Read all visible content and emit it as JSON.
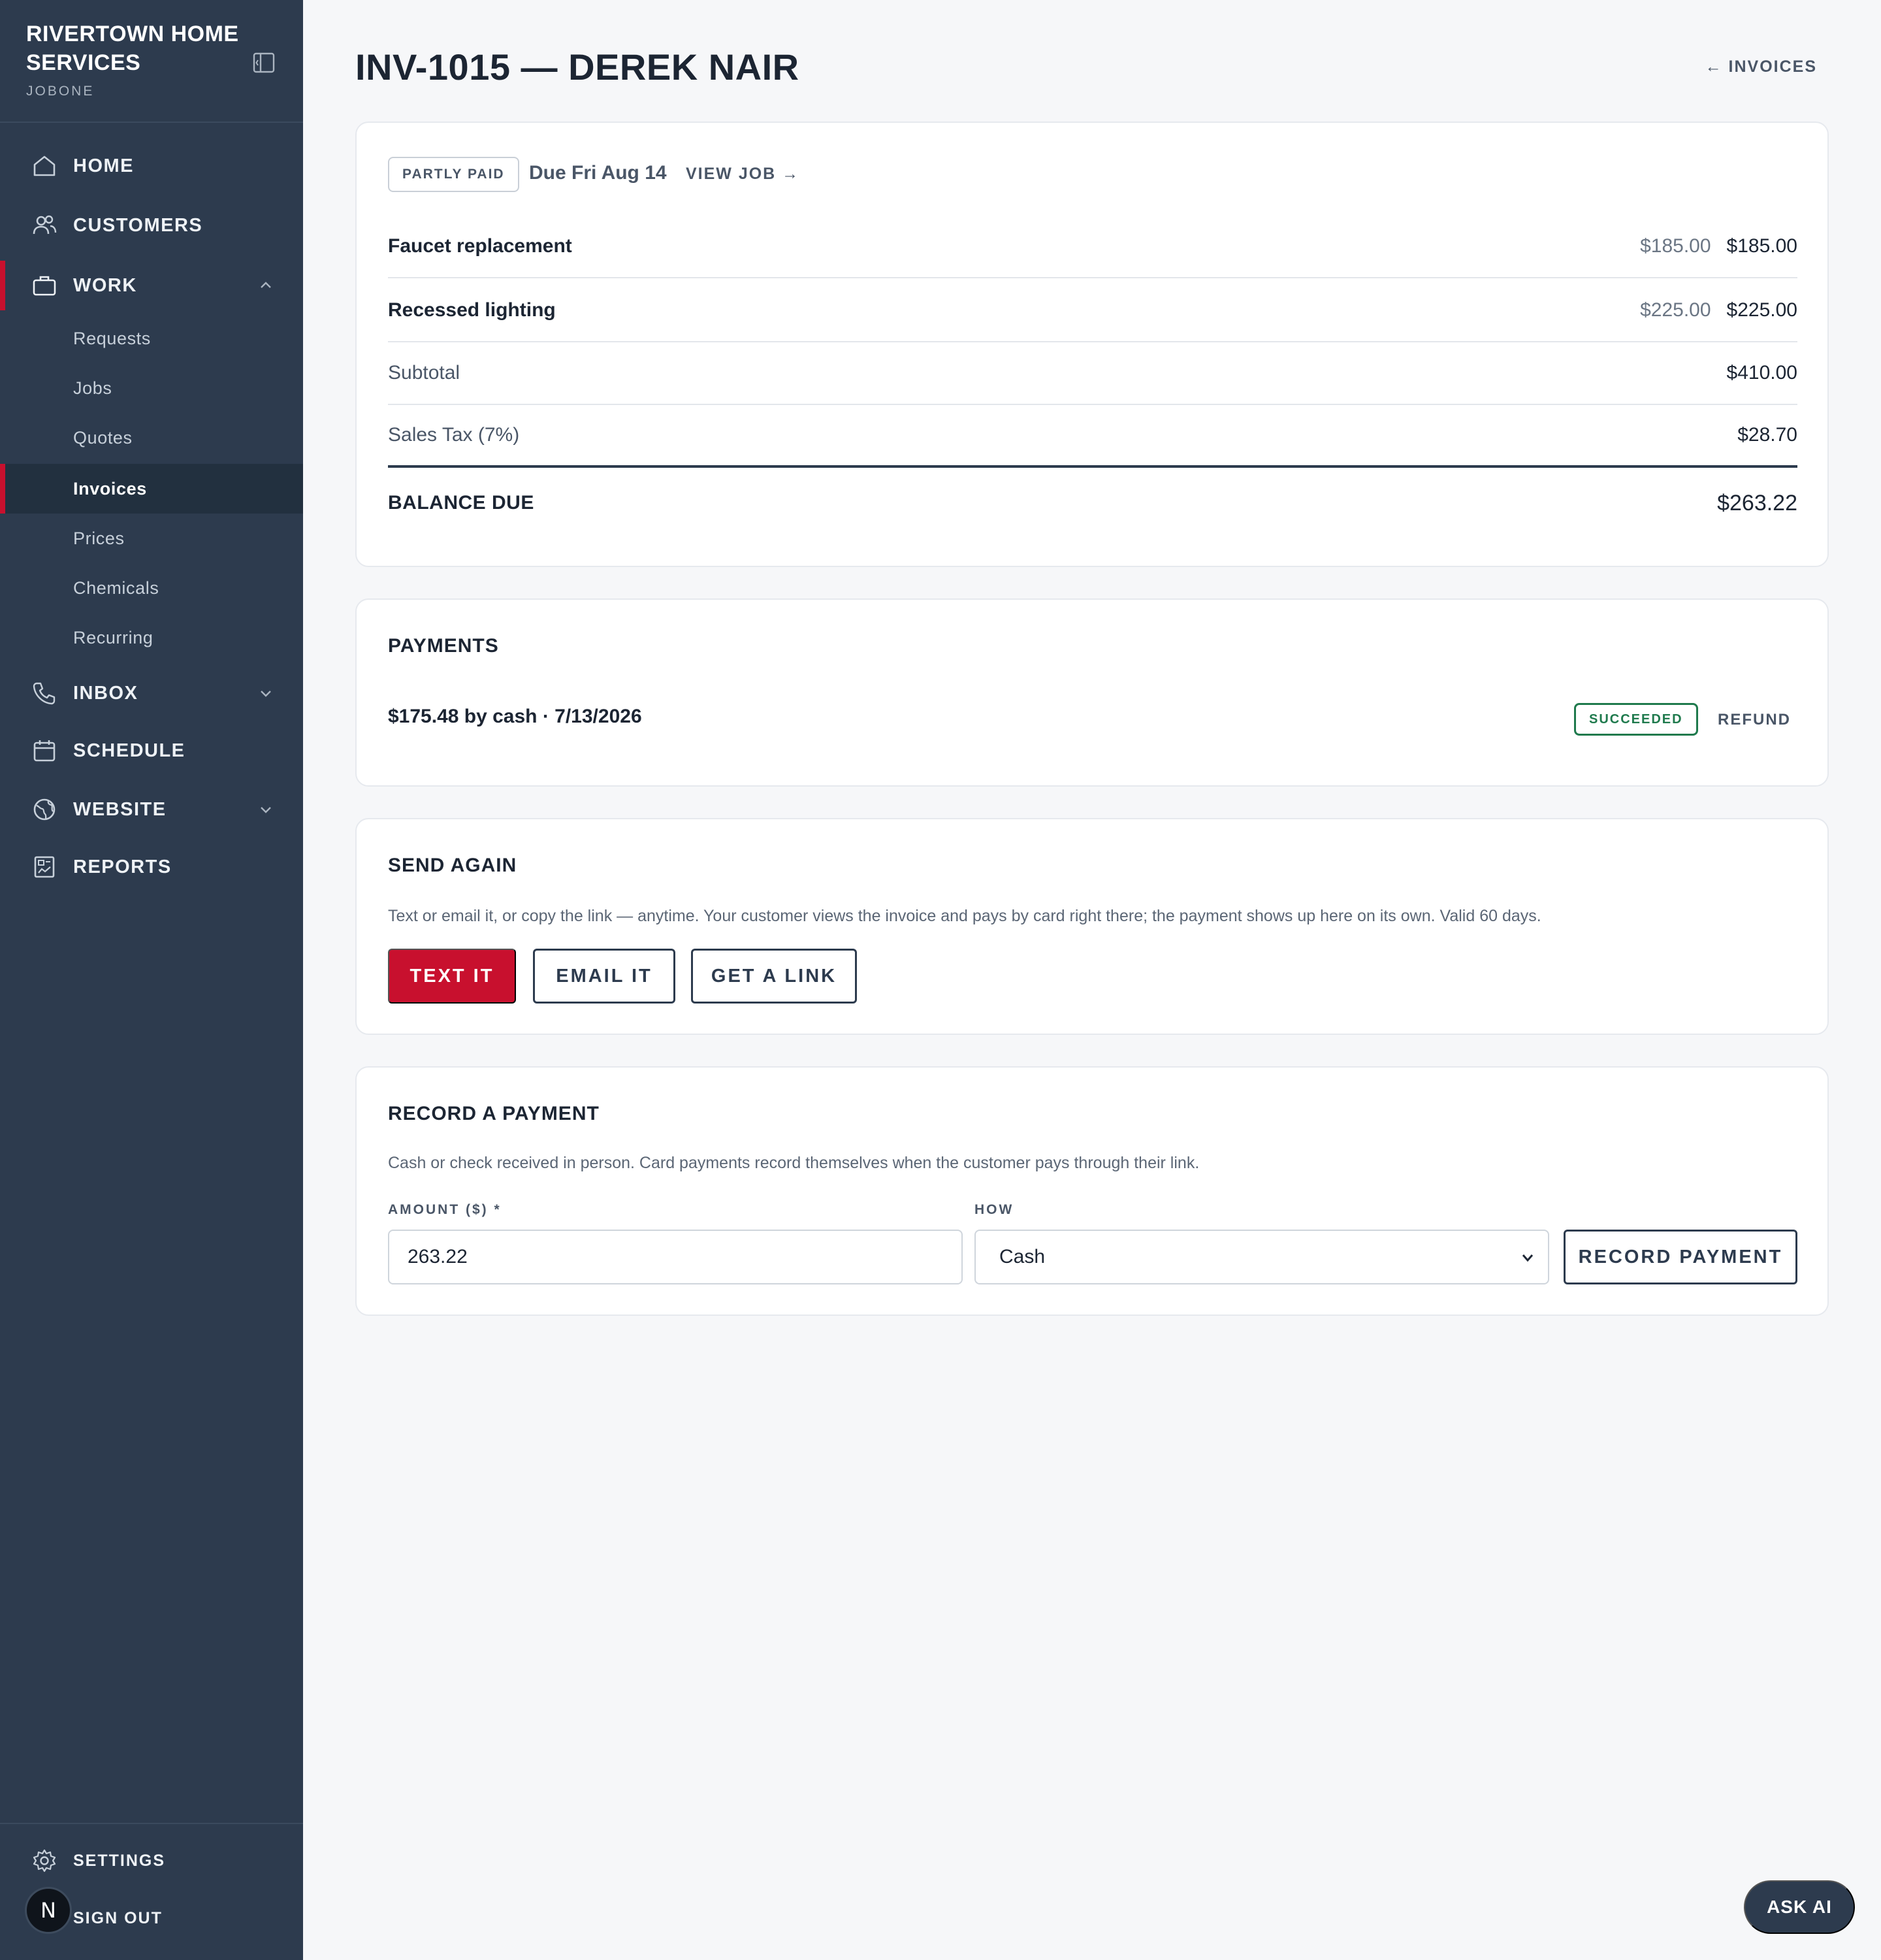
{
  "brand": {
    "name": "RIVERTOWN HOME SERVICES",
    "sub": "JOBONE"
  },
  "nav": {
    "home": "HOME",
    "customers": "CUSTOMERS",
    "work": "WORK",
    "work_items": [
      "Requests",
      "Jobs",
      "Quotes",
      "Invoices",
      "Prices",
      "Chemicals",
      "Recurring"
    ],
    "inbox": "INBOX",
    "schedule": "SCHEDULE",
    "website": "WEBSITE",
    "reports": "REPORTS",
    "settings": "SETTINGS",
    "sign_out": "SIGN OUT",
    "avatar_letter": "N",
    "active_item": "Invoices"
  },
  "page": {
    "title": "INV-1015 — DEREK NAIR",
    "back": "← INVOICES"
  },
  "invoice": {
    "status": "PARTLY PAID",
    "due": "Due Fri Aug 14",
    "view_job": "VIEW JOB →",
    "line_items": [
      {
        "name": "Faucet replacement",
        "unit": "$185.00",
        "total": "$185.00"
      },
      {
        "name": "Recessed lighting",
        "unit": "$225.00",
        "total": "$225.00"
      }
    ],
    "subtotal_label": "Subtotal",
    "subtotal": "$410.00",
    "tax_label": "Sales Tax (7%)",
    "tax": "$28.70",
    "balance_label": "BALANCE DUE",
    "balance": "$263.22"
  },
  "payments": {
    "title": "PAYMENTS",
    "entry": "$175.48 by cash · 7/13/2026",
    "status": "SUCCEEDED",
    "refund": "REFUND"
  },
  "send_again": {
    "title": "SEND AGAIN",
    "help": "Text or email it, or copy the link — anytime. Your customer views the invoice and pays by card right there; the payment shows up here on its own. Valid 60 days.",
    "text_it": "TEXT IT",
    "email_it": "EMAIL IT",
    "get_link": "GET A LINK"
  },
  "record_payment": {
    "title": "RECORD A PAYMENT",
    "help": "Cash or check received in person. Card payments record themselves when the customer pays through their link.",
    "amount_label": "AMOUNT ($) *",
    "amount_value": "263.22",
    "how_label": "HOW",
    "how_value": "Cash",
    "submit": "RECORD PAYMENT"
  },
  "ask_ai": "ASK AI",
  "colors": {
    "sidebar": "#2d3b4e",
    "accent": "#c8102e",
    "success": "#1f7a4d",
    "page_bg": "#f6f7f9"
  }
}
